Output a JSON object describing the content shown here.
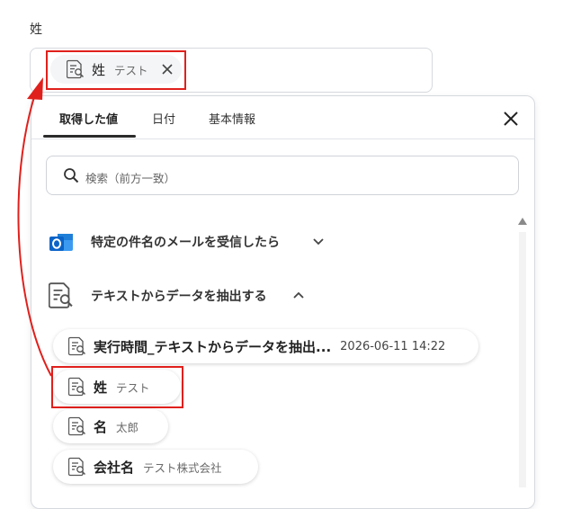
{
  "field": {
    "label": "姓"
  },
  "selected_chip": {
    "label": "姓",
    "value": "テスト"
  },
  "tabs": [
    {
      "label": "取得した値",
      "active": true
    },
    {
      "label": "日付",
      "active": false
    },
    {
      "label": "基本情報",
      "active": false
    }
  ],
  "search": {
    "placeholder": "検索（前方一致）"
  },
  "groups": [
    {
      "title": "特定の件名のメールを受信したら",
      "icon": "outlook-icon",
      "expanded": false
    },
    {
      "title": "テキストからデータを抽出する",
      "icon": "document-search-icon",
      "expanded": true
    }
  ],
  "items": [
    {
      "label": "実行時間_テキストからデータを抽出...",
      "value": "2026-06-11 14:22"
    },
    {
      "label": "姓",
      "value": "テスト"
    },
    {
      "label": "名",
      "value": "太郎"
    },
    {
      "label": "会社名",
      "value": "テスト株式会社"
    }
  ],
  "colors": {
    "highlight": "#e0201c",
    "outlook": "#0a64c8"
  }
}
